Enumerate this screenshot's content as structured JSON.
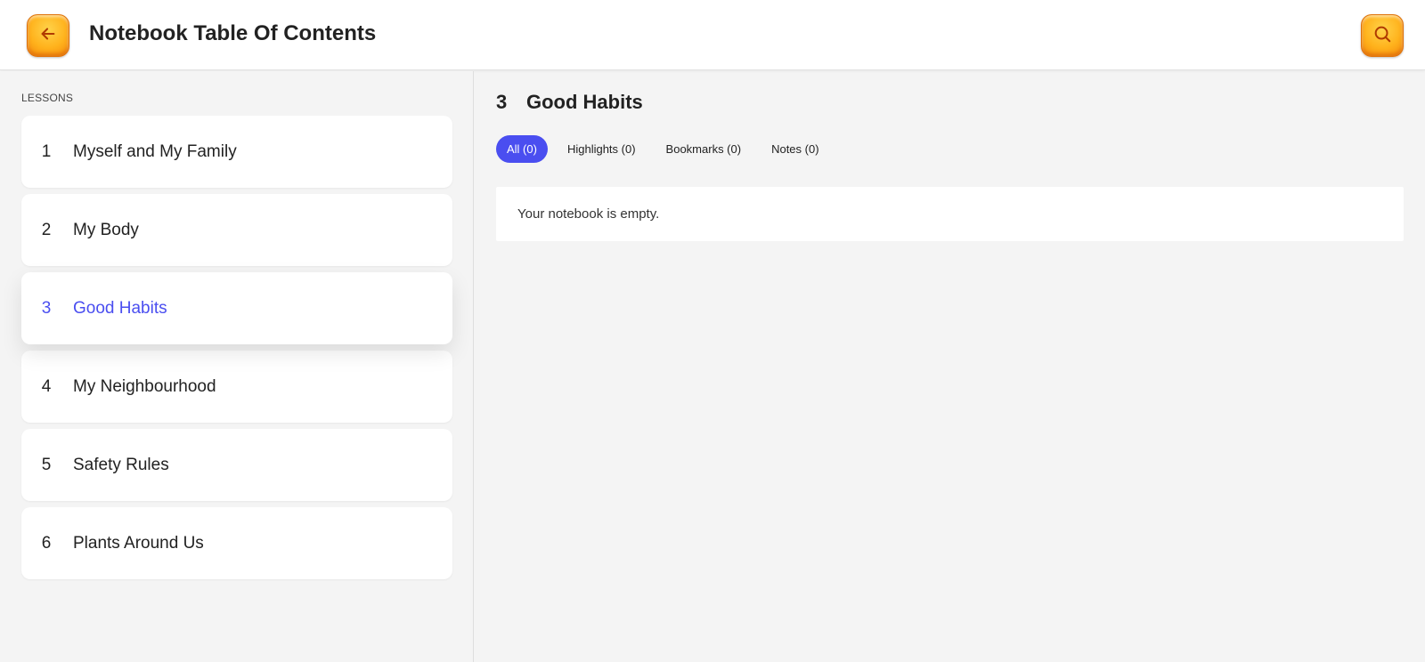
{
  "header": {
    "title": "Notebook Table Of Contents",
    "back_icon": "arrow-left-icon",
    "search_icon": "search-icon",
    "accent_color": "#ffb21c"
  },
  "sidebar": {
    "heading": "LESSONS",
    "lessons": [
      {
        "number": "1",
        "title": "Myself and My Family",
        "active": false
      },
      {
        "number": "2",
        "title": "My Body",
        "active": false
      },
      {
        "number": "3",
        "title": "Good Habits",
        "active": true
      },
      {
        "number": "4",
        "title": "My Neighbourhood",
        "active": false
      },
      {
        "number": "5",
        "title": "Safety Rules",
        "active": false
      },
      {
        "number": "6",
        "title": "Plants Around Us",
        "active": false
      }
    ],
    "active_color": "#4a4ef0"
  },
  "main": {
    "lesson_number": "3",
    "lesson_title": "Good Habits",
    "tabs": [
      {
        "label": "All (0)",
        "active": true
      },
      {
        "label": "Highlights (0)",
        "active": false
      },
      {
        "label": "Bookmarks (0)",
        "active": false
      },
      {
        "label": "Notes (0)",
        "active": false
      }
    ],
    "empty_message": "Your notebook is empty."
  }
}
